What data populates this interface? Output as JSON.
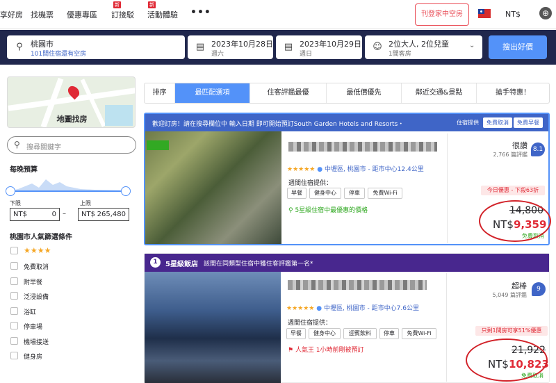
{
  "nav": {
    "items": [
      "享好房",
      "找機票",
      "優惠專區",
      "訂接駁",
      "活動體驗"
    ],
    "new_badge": "新",
    "more": "•••",
    "list_property": "刊登家中空房",
    "currency": "NT$",
    "zoom": "⊕"
  },
  "search": {
    "destination": "桃園市",
    "destination_sub": "101間住宿還有空房",
    "checkin_date": "2023年10月28日",
    "checkin_day": "週六",
    "checkout_date": "2023年10月29日",
    "checkout_day": "週日",
    "guests": "2位大人, 2位兒童",
    "rooms": "1間客房",
    "submit": "搜出好價"
  },
  "sidebar": {
    "map_label": "地圖找房",
    "search_placeholder": "搜尋關鍵字",
    "budget_title": "每晚預算",
    "min_label": "下限",
    "max_label": "上限",
    "min_currency": "NT$",
    "min_value": "0",
    "max_currency": "NT$",
    "max_value": "265,480",
    "popular_title": "桃園市人氣篩選條件",
    "filters": [
      "★★★★",
      "免費取消",
      "附早餐",
      "泛浸設備",
      "浴缸",
      "停車場",
      "機場接送",
      "健身房"
    ]
  },
  "sort": {
    "label": "排序",
    "options": [
      "最匹配選項",
      "住客評鑑最優",
      "最低價優先",
      "鄰近交通&景點",
      "搶手特惠！"
    ]
  },
  "card1": {
    "banner": "歡迎訂房！請在搜尋欄位中 輸入日期 即可開始預訂South Garden Hotels and Resorts・",
    "tags": [
      "住宿提供",
      "免費取消",
      "免費早餐"
    ],
    "stars": "★★★★★",
    "location_area": "中壢區, 桃園市",
    "location_distance": " - 距市中心12.4公里",
    "facilities_title": "週間住宿提供：",
    "chips": [
      "早餐",
      "健身中心",
      "停車",
      "免費Wi-Fi"
    ],
    "note": "5星級住宿中最優惠的價格",
    "rating_word": "很讚",
    "reviews": "2,766 篇評鑑",
    "score": "8.1",
    "deal": "今日優惠 - 下殺63折",
    "original_price": "14,800",
    "currency": "NT$",
    "price": "9,359",
    "free_cancel": "免費取消"
  },
  "card2": {
    "badge": "1",
    "banner_bold": "5星級飯店",
    "banner_text": "該間在同類型住宿中獲住客評鑑第一名*",
    "stars": "★★★★★",
    "location_area": "中壢區, 桃園市",
    "location_distance": " - 距市中心7.6公里",
    "facilities_title": "週間住宿提供：",
    "chips_row1": [
      "早餐",
      "健身中心",
      "迎賓飲料",
      "停車",
      "免費Wi-Fi"
    ],
    "note": "人氣王 1小時前剛被預訂",
    "rating_word": "超棒",
    "reviews": "5,049 篇評鑑",
    "score": "9",
    "deal": "只剩1間房可享51%優惠",
    "original_price": "21,922",
    "currency": "NT$",
    "price": "10,823",
    "free_cancel": "免費取消"
  },
  "colors": {
    "accent": "#5392f9",
    "navy": "#20274d",
    "purple": "#48278e",
    "red": "#e02a36",
    "green": "#32a923"
  }
}
